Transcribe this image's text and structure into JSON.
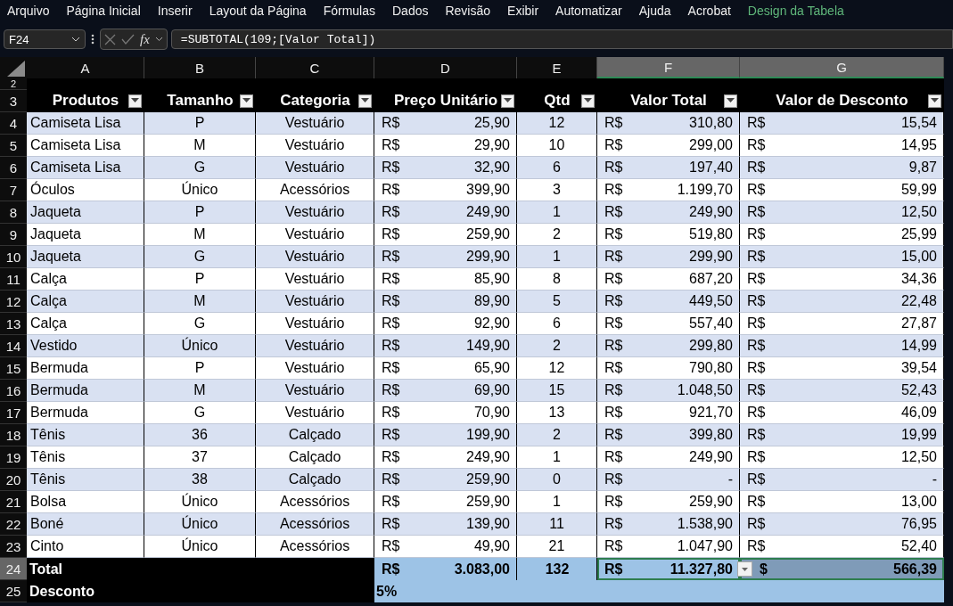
{
  "menu": [
    {
      "label": "Arquivo",
      "kind": "standard"
    },
    {
      "label": "Página Inicial",
      "kind": "standard"
    },
    {
      "label": "Inserir",
      "kind": "standard"
    },
    {
      "label": "Layout da Página",
      "kind": "standard"
    },
    {
      "label": "Fórmulas",
      "kind": "standard"
    },
    {
      "label": "Dados",
      "kind": "standard"
    },
    {
      "label": "Revisão",
      "kind": "standard"
    },
    {
      "label": "Exibir",
      "kind": "standard"
    },
    {
      "label": "Automatizar",
      "kind": "standard"
    },
    {
      "label": "Ajuda",
      "kind": "standard"
    },
    {
      "label": "Acrobat",
      "kind": "standard"
    },
    {
      "label": "Design da Tabela",
      "kind": "contextual"
    }
  ],
  "formula_bar": {
    "name_box": "F24",
    "function_button": "fx",
    "formula": "=SUBTOTAL(109;[Valor Total])"
  },
  "columns": [
    {
      "label": "A",
      "selected": false
    },
    {
      "label": "B",
      "selected": false
    },
    {
      "label": "C",
      "selected": false
    },
    {
      "label": "D",
      "selected": false
    },
    {
      "label": "E",
      "selected": false
    },
    {
      "label": "F",
      "selected": true
    },
    {
      "label": "G",
      "selected": true
    }
  ],
  "blank_row": {
    "number": "2"
  },
  "header_row": {
    "number": "3",
    "headers": [
      "Produtos",
      "Tamanho",
      "Categoria",
      "Preço Unitário",
      "Qtd",
      "Valor Total",
      "Valor de Desconto"
    ]
  },
  "rows": [
    {
      "number": "4",
      "banded": true,
      "produto": "Camiseta Lisa",
      "tamanho": "P",
      "categoria": "Vestuário",
      "preco": [
        "R$",
        "25,90"
      ],
      "qtd": "12",
      "valor_total": [
        "R$",
        "310,80"
      ],
      "desconto": [
        "R$",
        "15,54"
      ]
    },
    {
      "number": "5",
      "banded": false,
      "produto": "Camiseta Lisa",
      "tamanho": "M",
      "categoria": "Vestuário",
      "preco": [
        "R$",
        "29,90"
      ],
      "qtd": "10",
      "valor_total": [
        "R$",
        "299,00"
      ],
      "desconto": [
        "R$",
        "14,95"
      ]
    },
    {
      "number": "6",
      "banded": true,
      "produto": "Camiseta Lisa",
      "tamanho": "G",
      "categoria": "Vestuário",
      "preco": [
        "R$",
        "32,90"
      ],
      "qtd": "6",
      "valor_total": [
        "R$",
        "197,40"
      ],
      "desconto": [
        "R$",
        "9,87"
      ]
    },
    {
      "number": "7",
      "banded": false,
      "produto": "Óculos",
      "tamanho": "Único",
      "categoria": "Acessórios",
      "preco": [
        "R$",
        "399,90"
      ],
      "qtd": "3",
      "valor_total": [
        "R$",
        "1.199,70"
      ],
      "desconto": [
        "R$",
        "59,99"
      ]
    },
    {
      "number": "8",
      "banded": true,
      "produto": "Jaqueta",
      "tamanho": "P",
      "categoria": "Vestuário",
      "preco": [
        "R$",
        "249,90"
      ],
      "qtd": "1",
      "valor_total": [
        "R$",
        "249,90"
      ],
      "desconto": [
        "R$",
        "12,50"
      ]
    },
    {
      "number": "9",
      "banded": false,
      "produto": "Jaqueta",
      "tamanho": "M",
      "categoria": "Vestuário",
      "preco": [
        "R$",
        "259,90"
      ],
      "qtd": "2",
      "valor_total": [
        "R$",
        "519,80"
      ],
      "desconto": [
        "R$",
        "25,99"
      ]
    },
    {
      "number": "10",
      "banded": true,
      "produto": "Jaqueta",
      "tamanho": "G",
      "categoria": "Vestuário",
      "preco": [
        "R$",
        "299,90"
      ],
      "qtd": "1",
      "valor_total": [
        "R$",
        "299,90"
      ],
      "desconto": [
        "R$",
        "15,00"
      ]
    },
    {
      "number": "11",
      "banded": false,
      "produto": "Calça",
      "tamanho": "P",
      "categoria": "Vestuário",
      "preco": [
        "R$",
        "85,90"
      ],
      "qtd": "8",
      "valor_total": [
        "R$",
        "687,20"
      ],
      "desconto": [
        "R$",
        "34,36"
      ]
    },
    {
      "number": "12",
      "banded": true,
      "produto": "Calça",
      "tamanho": "M",
      "categoria": "Vestuário",
      "preco": [
        "R$",
        "89,90"
      ],
      "qtd": "5",
      "valor_total": [
        "R$",
        "449,50"
      ],
      "desconto": [
        "R$",
        "22,48"
      ]
    },
    {
      "number": "13",
      "banded": false,
      "produto": "Calça",
      "tamanho": "G",
      "categoria": "Vestuário",
      "preco": [
        "R$",
        "92,90"
      ],
      "qtd": "6",
      "valor_total": [
        "R$",
        "557,40"
      ],
      "desconto": [
        "R$",
        "27,87"
      ]
    },
    {
      "number": "14",
      "banded": true,
      "produto": "Vestido",
      "tamanho": "Único",
      "categoria": "Vestuário",
      "preco": [
        "R$",
        "149,90"
      ],
      "qtd": "2",
      "valor_total": [
        "R$",
        "299,80"
      ],
      "desconto": [
        "R$",
        "14,99"
      ]
    },
    {
      "number": "15",
      "banded": false,
      "produto": "Bermuda",
      "tamanho": "P",
      "categoria": "Vestuário",
      "preco": [
        "R$",
        "65,90"
      ],
      "qtd": "12",
      "valor_total": [
        "R$",
        "790,80"
      ],
      "desconto": [
        "R$",
        "39,54"
      ]
    },
    {
      "number": "16",
      "banded": true,
      "produto": "Bermuda",
      "tamanho": "M",
      "categoria": "Vestuário",
      "preco": [
        "R$",
        "69,90"
      ],
      "qtd": "15",
      "valor_total": [
        "R$",
        "1.048,50"
      ],
      "desconto": [
        "R$",
        "52,43"
      ]
    },
    {
      "number": "17",
      "banded": false,
      "produto": "Bermuda",
      "tamanho": "G",
      "categoria": "Vestuário",
      "preco": [
        "R$",
        "70,90"
      ],
      "qtd": "13",
      "valor_total": [
        "R$",
        "921,70"
      ],
      "desconto": [
        "R$",
        "46,09"
      ]
    },
    {
      "number": "18",
      "banded": true,
      "produto": "Tênis",
      "tamanho": "36",
      "categoria": "Calçado",
      "preco": [
        "R$",
        "199,90"
      ],
      "qtd": "2",
      "valor_total": [
        "R$",
        "399,80"
      ],
      "desconto": [
        "R$",
        "19,99"
      ]
    },
    {
      "number": "19",
      "banded": false,
      "produto": "Tênis",
      "tamanho": "37",
      "categoria": "Calçado",
      "preco": [
        "R$",
        "249,90"
      ],
      "qtd": "1",
      "valor_total": [
        "R$",
        "249,90"
      ],
      "desconto": [
        "R$",
        "12,50"
      ]
    },
    {
      "number": "20",
      "banded": true,
      "produto": "Tênis",
      "tamanho": "38",
      "categoria": "Calçado",
      "preco": [
        "R$",
        "259,90"
      ],
      "qtd": "0",
      "valor_total": [
        "R$",
        "-"
      ],
      "desconto": [
        "R$",
        "-"
      ]
    },
    {
      "number": "21",
      "banded": false,
      "produto": "Bolsa",
      "tamanho": "Único",
      "categoria": "Acessórios",
      "preco": [
        "R$",
        "259,90"
      ],
      "qtd": "1",
      "valor_total": [
        "R$",
        "259,90"
      ],
      "desconto": [
        "R$",
        "13,00"
      ]
    },
    {
      "number": "22",
      "banded": true,
      "produto": "Boné",
      "tamanho": "Único",
      "categoria": "Acessórios",
      "preco": [
        "R$",
        "139,90"
      ],
      "qtd": "11",
      "valor_total": [
        "R$",
        "1.538,90"
      ],
      "desconto": [
        "R$",
        "76,95"
      ]
    },
    {
      "number": "23",
      "banded": false,
      "produto": "Cinto",
      "tamanho": "Único",
      "categoria": "Acessórios",
      "preco": [
        "R$",
        "49,90"
      ],
      "qtd": "21",
      "valor_total": [
        "R$",
        "1.047,90"
      ],
      "desconto": [
        "R$",
        "52,40"
      ]
    }
  ],
  "total_row": {
    "number": "24",
    "selected": true,
    "label": "Total",
    "preco": [
      "R$",
      "3.083,00"
    ],
    "qtd": "132",
    "valor_total": [
      "R$",
      "11.327,80"
    ],
    "desconto": [
      "$",
      "566,39"
    ],
    "desconto_selected": true
  },
  "discount_row": {
    "number": "25",
    "selected": false,
    "label": "Desconto",
    "value": "5%"
  }
}
